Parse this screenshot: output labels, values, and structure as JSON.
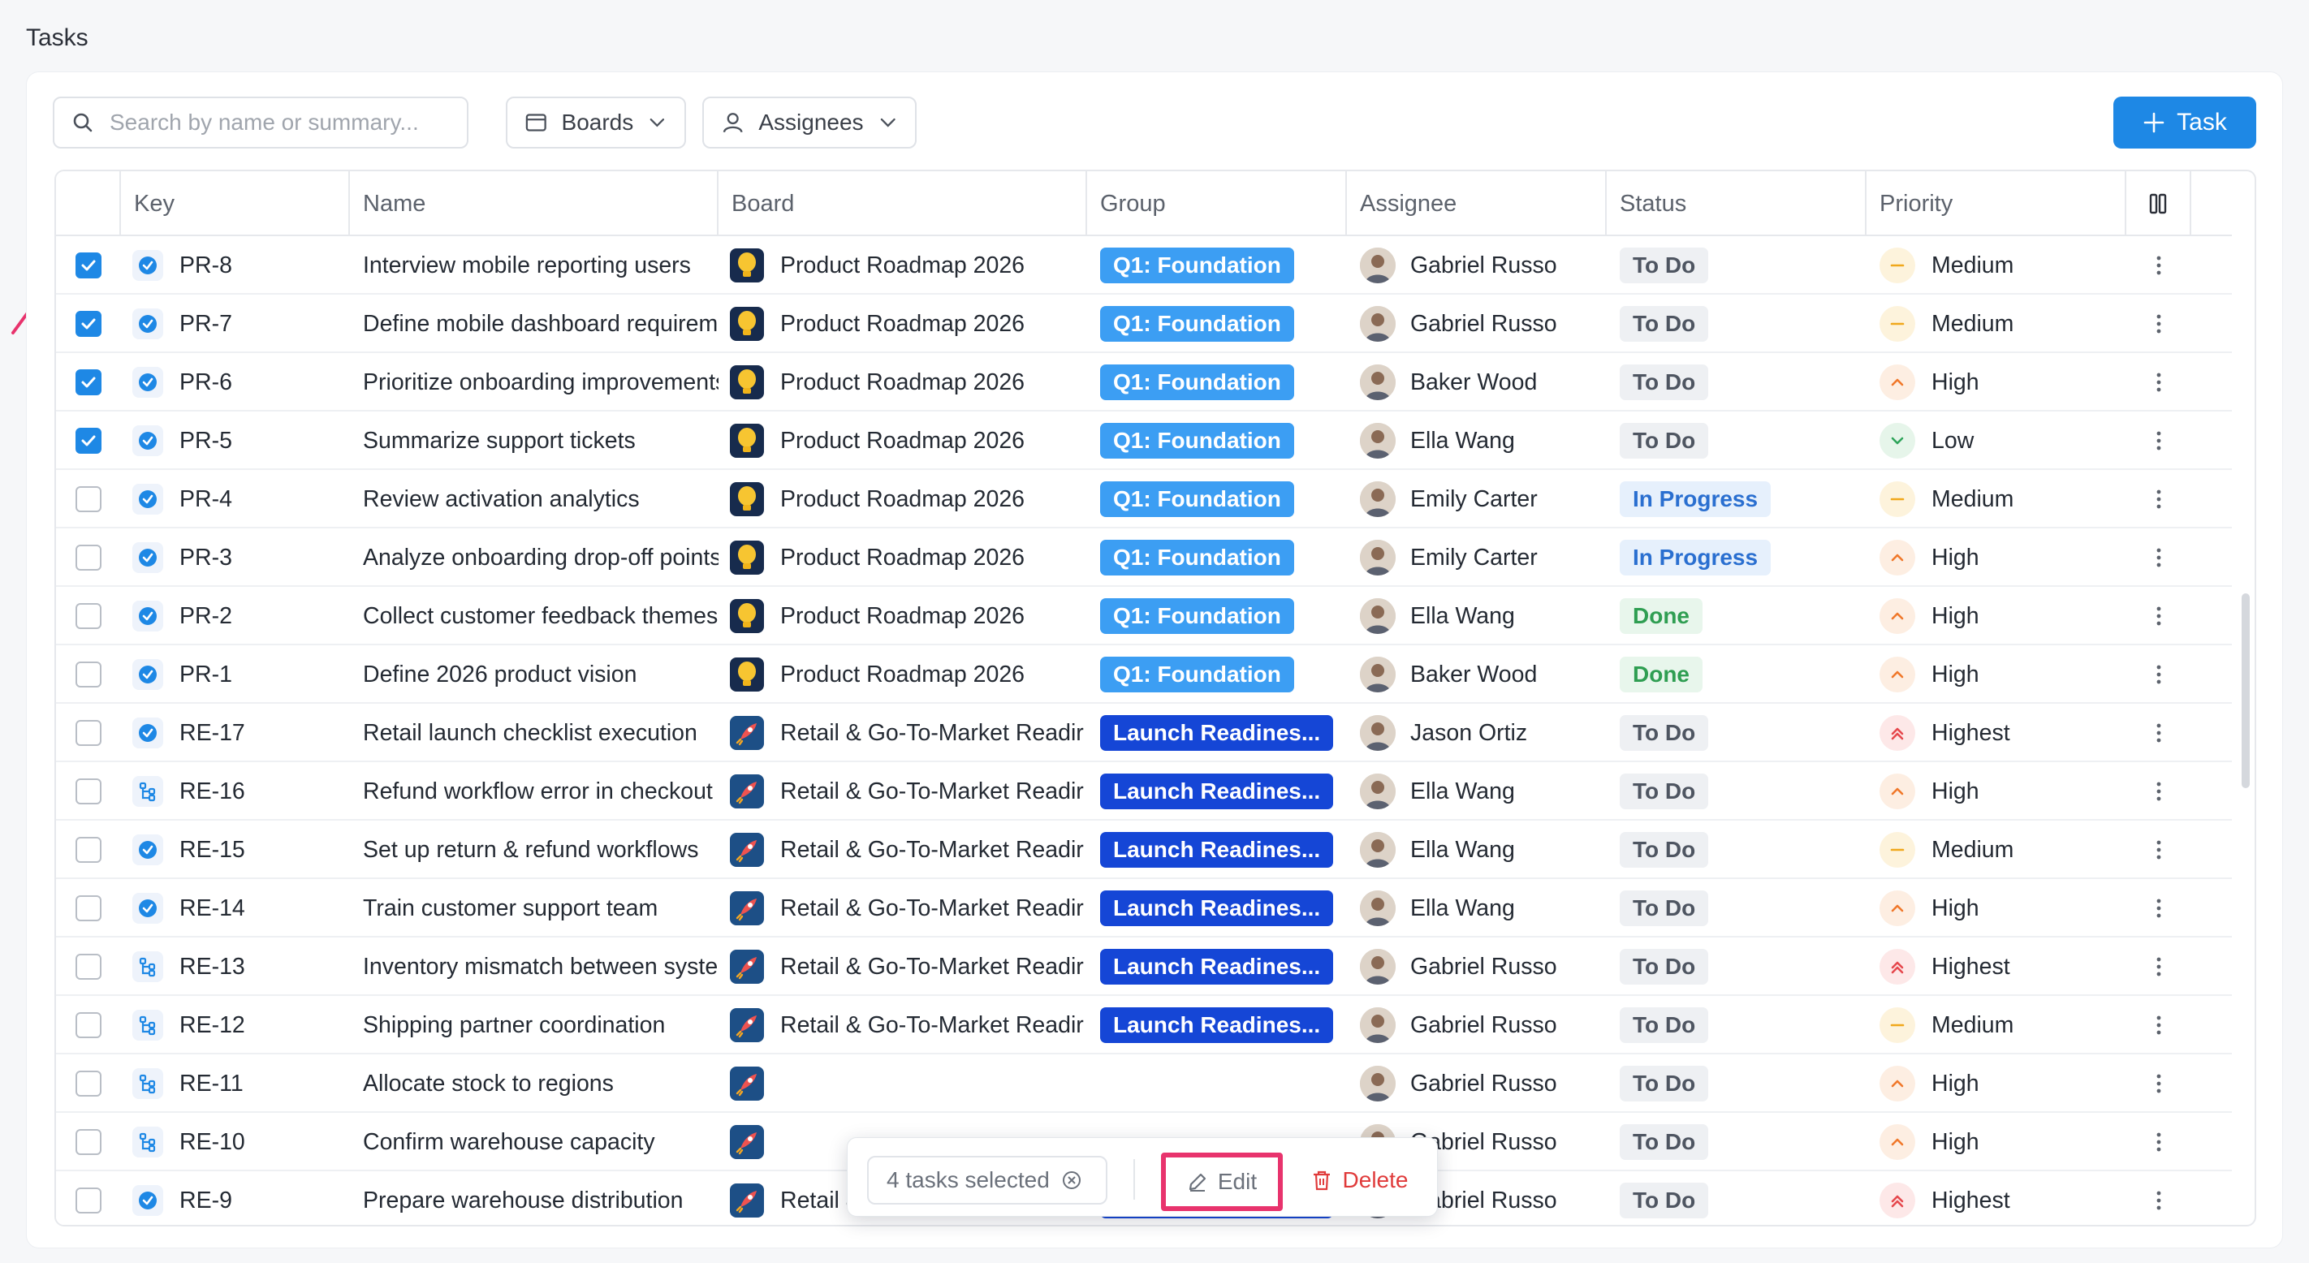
{
  "page": {
    "title": "Tasks"
  },
  "toolbar": {
    "search_placeholder": "Search by name or summary...",
    "boards_label": "Boards",
    "assignees_label": "Assignees",
    "add_task_label": "Task"
  },
  "columns": {
    "key": "Key",
    "name": "Name",
    "board": "Board",
    "group": "Group",
    "assignee": "Assignee",
    "status": "Status",
    "priority": "Priority"
  },
  "colors": {
    "accent": "#1e88e5",
    "q1_group": "#3c9ef3",
    "launch_group": "#1546d6",
    "highlight": "#e8336d"
  },
  "rows": [
    {
      "checked": true,
      "type": "task",
      "key": "PR-8",
      "name": "Interview mobile reporting users",
      "board": "Product Roadmap 2026",
      "board_icon": "lightbulb-icon",
      "group": "Q1: Foundation",
      "group_style": "q1",
      "assignee": "Gabriel Russo",
      "status": "To Do",
      "status_style": "todo",
      "priority": "Medium",
      "priority_style": "medium"
    },
    {
      "checked": true,
      "type": "task",
      "key": "PR-7",
      "name": "Define mobile dashboard requirements",
      "board": "Product Roadmap 2026",
      "board_icon": "lightbulb-icon",
      "group": "Q1: Foundation",
      "group_style": "q1",
      "assignee": "Gabriel Russo",
      "status": "To Do",
      "status_style": "todo",
      "priority": "Medium",
      "priority_style": "medium"
    },
    {
      "checked": true,
      "type": "task",
      "key": "PR-6",
      "name": "Prioritize onboarding improvements",
      "board": "Product Roadmap 2026",
      "board_icon": "lightbulb-icon",
      "group": "Q1: Foundation",
      "group_style": "q1",
      "assignee": "Baker Wood",
      "status": "To Do",
      "status_style": "todo",
      "priority": "High",
      "priority_style": "high"
    },
    {
      "checked": true,
      "type": "task",
      "key": "PR-5",
      "name": "Summarize support tickets",
      "board": "Product Roadmap 2026",
      "board_icon": "lightbulb-icon",
      "group": "Q1: Foundation",
      "group_style": "q1",
      "assignee": "Ella Wang",
      "status": "To Do",
      "status_style": "todo",
      "priority": "Low",
      "priority_style": "low"
    },
    {
      "checked": false,
      "type": "task",
      "key": "PR-4",
      "name": "Review activation analytics",
      "board": "Product Roadmap 2026",
      "board_icon": "lightbulb-icon",
      "group": "Q1: Foundation",
      "group_style": "q1",
      "assignee": "Emily Carter",
      "status": "In Progress",
      "status_style": "prog",
      "priority": "Medium",
      "priority_style": "medium"
    },
    {
      "checked": false,
      "type": "task",
      "key": "PR-3",
      "name": "Analyze onboarding drop-off points",
      "board": "Product Roadmap 2026",
      "board_icon": "lightbulb-icon",
      "group": "Q1: Foundation",
      "group_style": "q1",
      "assignee": "Emily Carter",
      "status": "In Progress",
      "status_style": "prog",
      "priority": "High",
      "priority_style": "high"
    },
    {
      "checked": false,
      "type": "task",
      "key": "PR-2",
      "name": "Collect customer feedback themes",
      "board": "Product Roadmap 2026",
      "board_icon": "lightbulb-icon",
      "group": "Q1: Foundation",
      "group_style": "q1",
      "assignee": "Ella Wang",
      "status": "Done",
      "status_style": "done",
      "priority": "High",
      "priority_style": "high"
    },
    {
      "checked": false,
      "type": "task",
      "key": "PR-1",
      "name": "Define 2026 product vision",
      "board": "Product Roadmap 2026",
      "board_icon": "lightbulb-icon",
      "group": "Q1: Foundation",
      "group_style": "q1",
      "assignee": "Baker Wood",
      "status": "Done",
      "status_style": "done",
      "priority": "High",
      "priority_style": "high"
    },
    {
      "checked": false,
      "type": "task",
      "key": "RE-17",
      "name": "Retail launch checklist execution",
      "board": "Retail & Go-To-Market Readir",
      "board_icon": "rocket-icon",
      "group": "Launch Readines...",
      "group_style": "launch",
      "assignee": "Jason Ortiz",
      "status": "To Do",
      "status_style": "todo",
      "priority": "Highest",
      "priority_style": "highest"
    },
    {
      "checked": false,
      "type": "subtask",
      "key": "RE-16",
      "name": "Refund workflow error in checkout syste...",
      "board": "Retail & Go-To-Market Readir",
      "board_icon": "rocket-icon",
      "group": "Launch Readines...",
      "group_style": "launch",
      "assignee": "Ella Wang",
      "status": "To Do",
      "status_style": "todo",
      "priority": "High",
      "priority_style": "high"
    },
    {
      "checked": false,
      "type": "task",
      "key": "RE-15",
      "name": "Set up return & refund workflows",
      "board": "Retail & Go-To-Market Readir",
      "board_icon": "rocket-icon",
      "group": "Launch Readines...",
      "group_style": "launch",
      "assignee": "Ella Wang",
      "status": "To Do",
      "status_style": "todo",
      "priority": "Medium",
      "priority_style": "medium"
    },
    {
      "checked": false,
      "type": "task",
      "key": "RE-14",
      "name": "Train customer support team",
      "board": "Retail & Go-To-Market Readir",
      "board_icon": "rocket-icon",
      "group": "Launch Readines...",
      "group_style": "launch",
      "assignee": "Ella Wang",
      "status": "To Do",
      "status_style": "todo",
      "priority": "High",
      "priority_style": "high"
    },
    {
      "checked": false,
      "type": "subtask",
      "key": "RE-13",
      "name": "Inventory mismatch between system & ...",
      "board": "Retail & Go-To-Market Readir",
      "board_icon": "rocket-icon",
      "group": "Launch Readines...",
      "group_style": "launch",
      "assignee": "Gabriel Russo",
      "status": "To Do",
      "status_style": "todo",
      "priority": "Highest",
      "priority_style": "highest"
    },
    {
      "checked": false,
      "type": "subtask",
      "key": "RE-12",
      "name": "Shipping partner coordination",
      "board": "Retail & Go-To-Market Readir",
      "board_icon": "rocket-icon",
      "group": "Launch Readines...",
      "group_style": "launch",
      "assignee": "Gabriel Russo",
      "status": "To Do",
      "status_style": "todo",
      "priority": "Medium",
      "priority_style": "medium"
    },
    {
      "checked": false,
      "type": "subtask",
      "key": "RE-11",
      "name": "Allocate stock to regions",
      "board": "",
      "board_icon": "rocket-icon",
      "group": "",
      "group_style": "launch",
      "assignee": "Gabriel Russo",
      "status": "To Do",
      "status_style": "todo",
      "priority": "High",
      "priority_style": "high"
    },
    {
      "checked": false,
      "type": "subtask",
      "key": "RE-10",
      "name": "Confirm warehouse capacity",
      "board": "",
      "board_icon": "rocket-icon",
      "group": "",
      "group_style": "launch",
      "assignee": "Gabriel Russo",
      "status": "To Do",
      "status_style": "todo",
      "priority": "High",
      "priority_style": "high"
    },
    {
      "checked": false,
      "type": "task",
      "key": "RE-9",
      "name": "Prepare warehouse distribution",
      "board": "Retail & Go-To-Market Readir",
      "board_icon": "rocket-icon",
      "group": "Launch Readines...",
      "group_style": "launch",
      "assignee": "Gabriel Russo",
      "status": "To Do",
      "status_style": "todo",
      "priority": "Highest",
      "priority_style": "highest"
    }
  ],
  "bulk_actions": {
    "selected_label": "4 tasks selected",
    "edit_label": "Edit",
    "delete_label": "Delete"
  }
}
